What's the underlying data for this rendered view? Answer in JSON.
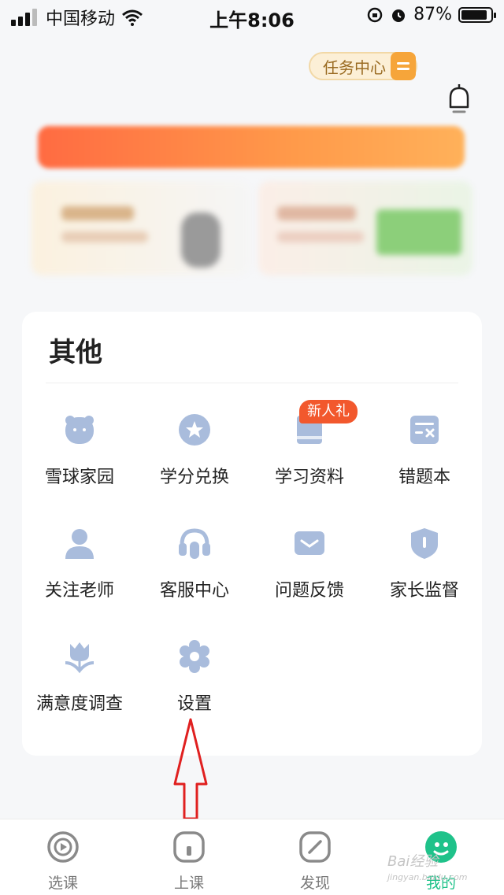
{
  "status_bar": {
    "carrier": "中国移动",
    "time": "上午8:06",
    "battery": "87%"
  },
  "header": {
    "task_center": "任务中心"
  },
  "section": {
    "title": "其他",
    "badge": "新人礼",
    "items": [
      {
        "label": "雪球家园",
        "icon": "bear-icon"
      },
      {
        "label": "学分兑换",
        "icon": "star-coin-icon"
      },
      {
        "label": "学习资料",
        "icon": "book-icon"
      },
      {
        "label": "错题本",
        "icon": "error-book-icon"
      },
      {
        "label": "关注老师",
        "icon": "person-icon"
      },
      {
        "label": "客服中心",
        "icon": "headset-icon"
      },
      {
        "label": "问题反馈",
        "icon": "mail-icon"
      },
      {
        "label": "家长监督",
        "icon": "shield-icon"
      },
      {
        "label": "满意度调查",
        "icon": "flower-icon"
      },
      {
        "label": "设置",
        "icon": "gear-icon"
      }
    ]
  },
  "tabbar": {
    "tabs": [
      {
        "label": "选课",
        "icon": "play-circle-icon",
        "active": false
      },
      {
        "label": "上课",
        "icon": "class-icon",
        "active": false
      },
      {
        "label": "发现",
        "icon": "compass-icon",
        "active": false
      },
      {
        "label": "我的",
        "icon": "avatar-icon",
        "active": true
      }
    ]
  },
  "watermark": {
    "brand": "Bai经验",
    "url": "jingyan.baidu.com"
  },
  "colors": {
    "icon": "#a9bcdc",
    "accent": "#1fc28a",
    "badge": "#f2582d",
    "arrow": "#e02020"
  }
}
